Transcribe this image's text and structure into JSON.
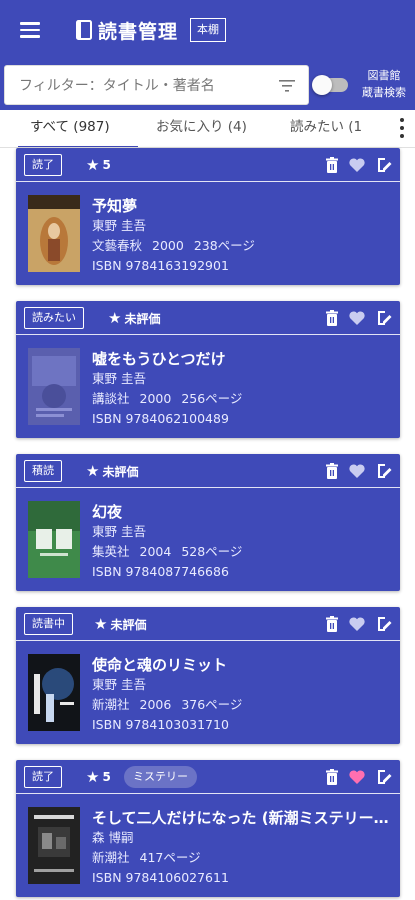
{
  "app": {
    "title": "読書管理",
    "shelf_label": "本棚"
  },
  "filter": {
    "placeholder": "フィルター：タイトル・著者名",
    "library_search": [
      "図書館",
      "蔵書検索"
    ]
  },
  "tabs": [
    {
      "label": "すべて (987)",
      "active": true
    },
    {
      "label": "お気に入り (4)",
      "active": false
    },
    {
      "label": "読みたい (1",
      "active": false
    }
  ],
  "books": [
    {
      "status": "読了",
      "rating_star": "★",
      "rating": "5",
      "title": "予知夢",
      "author": "東野 圭吾",
      "publisher": "文藝春秋",
      "year": "2000",
      "pages": "238ページ",
      "isbn": "ISBN 9784163192901",
      "favorite": false,
      "genre": ""
    },
    {
      "status": "読みたい",
      "rating_star": "★",
      "rating": "未評価",
      "title": "嘘をもうひとつだけ",
      "author": "東野 圭吾",
      "publisher": "講談社",
      "year": "2000",
      "pages": "256ページ",
      "isbn": "ISBN 9784062100489",
      "favorite": false,
      "genre": ""
    },
    {
      "status": "積読",
      "rating_star": "★",
      "rating": "未評価",
      "title": "幻夜",
      "author": "東野 圭吾",
      "publisher": "集英社",
      "year": "2004",
      "pages": "528ページ",
      "isbn": "ISBN 9784087746686",
      "favorite": false,
      "genre": ""
    },
    {
      "status": "読書中",
      "rating_star": "★",
      "rating": "未評価",
      "title": "使命と魂のリミット",
      "author": "東野 圭吾",
      "publisher": "新潮社",
      "year": "2006",
      "pages": "376ページ",
      "isbn": "ISBN 9784103031710",
      "favorite": false,
      "genre": ""
    },
    {
      "status": "読了",
      "rating_star": "★",
      "rating": "5",
      "title": "そして二人だけになった (新潮ミステリー倶楽部)",
      "author": "森 博嗣",
      "publisher": "新潮社",
      "year": "",
      "pages": "417ページ",
      "isbn": "ISBN 9784106027611",
      "favorite": true,
      "genre": "ミステリー"
    }
  ],
  "colors": {
    "primary": "#3f4ab8",
    "favorite_active": "#ff6fb0",
    "favorite_inactive": "#c9ccf0"
  }
}
